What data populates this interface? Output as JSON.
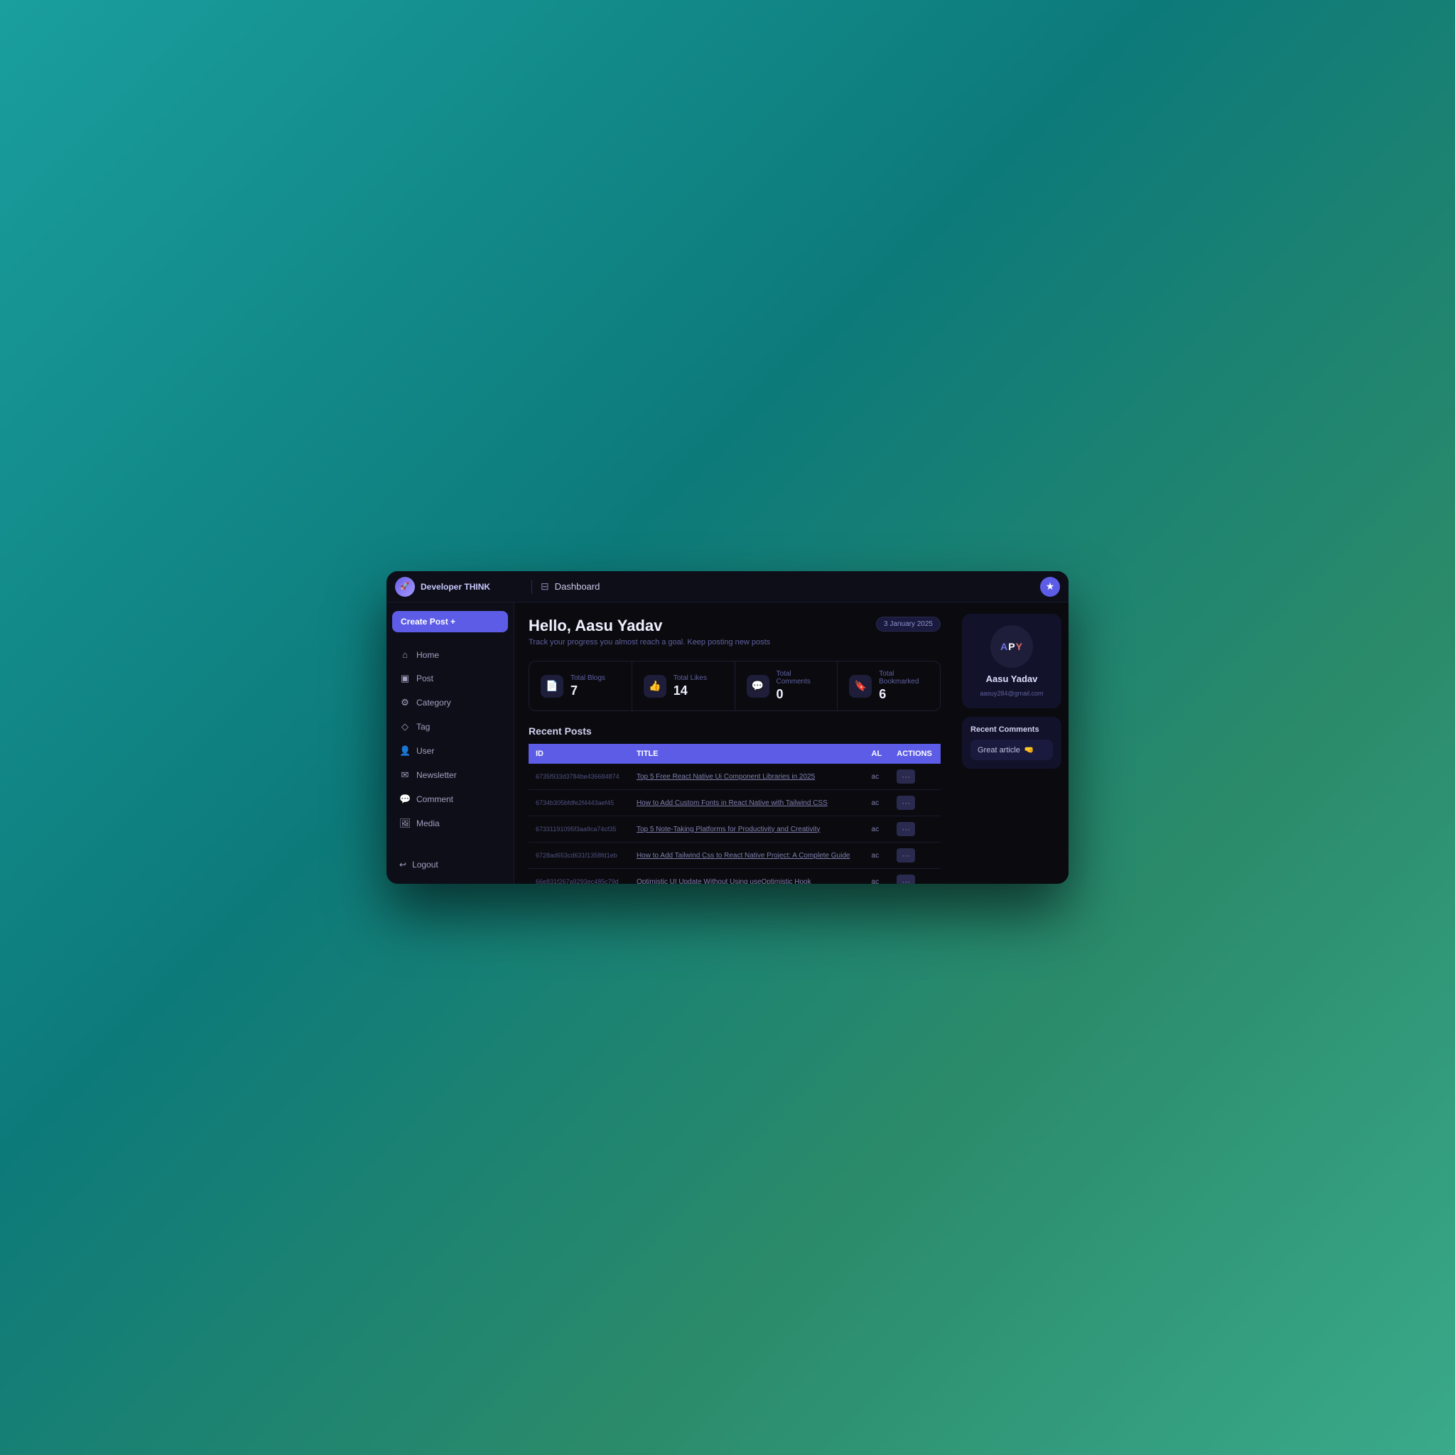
{
  "app": {
    "name": "Developer THINK",
    "page": "Dashboard",
    "icon_label": "★"
  },
  "topbar": {
    "logo_initials": "🚀",
    "page_title": "Dashboard"
  },
  "sidebar": {
    "create_post_label": "Create Post +",
    "nav_items": [
      {
        "id": "home",
        "icon": "⌂",
        "label": "Home"
      },
      {
        "id": "post",
        "icon": "▣",
        "label": "Post"
      },
      {
        "id": "category",
        "icon": "⚙",
        "label": "Category"
      },
      {
        "id": "tag",
        "icon": "◇",
        "label": "Tag"
      },
      {
        "id": "user",
        "icon": "👤",
        "label": "User"
      },
      {
        "id": "newsletter",
        "icon": "✉",
        "label": "Newsletter"
      },
      {
        "id": "comment",
        "icon": "💬",
        "label": "Comment"
      },
      {
        "id": "media",
        "icon": "🖼",
        "label": "Media"
      }
    ],
    "logout_label": "Logout"
  },
  "main": {
    "greeting": "Hello, Aasu Yadav",
    "subtitle": "Track your progress you almost reach a goal. Keep posting new posts",
    "date": "3 January 2025",
    "stats": [
      {
        "icon": "📄",
        "label": "Total Blogs",
        "value": "7"
      },
      {
        "icon": "👍",
        "label": "Total Likes",
        "value": "14"
      },
      {
        "icon": "💬",
        "label": "Total Comments",
        "value": "0"
      },
      {
        "icon": "🔖",
        "label": "Total Bookmarked",
        "value": "6"
      }
    ],
    "recent_posts_title": "Recent Posts",
    "table_headers": [
      "ID",
      "TITLE",
      "AL",
      "ACTIONS"
    ],
    "posts": [
      {
        "id": "6735f933d3784be436684874",
        "title": "Top 5 Free React Native Ui Component Libraries in 2025",
        "al": "ac",
        "actions": "..."
      },
      {
        "id": "6734b305bfdfe2f4443aef45",
        "title": "How to Add Custom Fonts in React Native with Tailwind CSS",
        "al": "ac",
        "actions": "..."
      },
      {
        "id": "67331191095f3aa9ca74cf35",
        "title": "Top 5 Note-Taking Platforms for Productivity and Creativity",
        "al": "ac",
        "actions": "..."
      },
      {
        "id": "6728ad653cd631f1358fd1eb",
        "title": "How to Add Tailwind Css to React Native Project: A Complete Guide",
        "al": "ac",
        "actions": "..."
      },
      {
        "id": "66e831f267a9293ec485c79d",
        "title": "Optimistic UI Update Without Using useOptimistic Hook",
        "al": "ac",
        "actions": "..."
      }
    ]
  },
  "profile": {
    "avatar_text": "APY",
    "name": "Aasu Yadav",
    "email": "aasuy284@gmail.com"
  },
  "recent_comments": {
    "title": "Recent Comments",
    "items": [
      {
        "text": "Great article",
        "emoji": "🤜"
      }
    ]
  }
}
